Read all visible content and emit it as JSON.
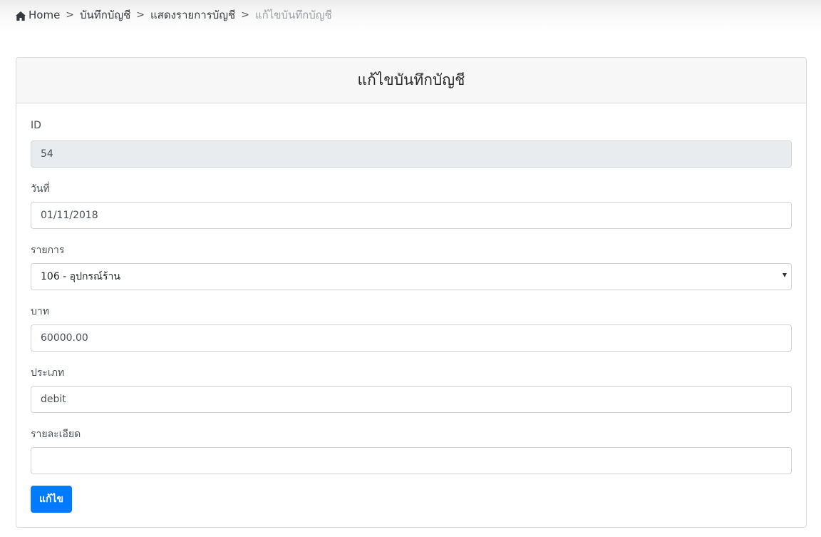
{
  "breadcrumb": {
    "home_label": "Home",
    "items": [
      "บันทึกบัญชี",
      "แสดงรายการบัญชี"
    ],
    "current": "แก้ไขบันทึกบัญชี",
    "separator": ">"
  },
  "card": {
    "title": "แก้ไขบันทึกบัญชี"
  },
  "form": {
    "id": {
      "label": "ID",
      "value": "54"
    },
    "date": {
      "label": "วันที่",
      "value": "01/11/2018"
    },
    "item": {
      "label": "รายการ",
      "selected": "106 - อุปกรณ์ร้าน"
    },
    "amount": {
      "label": "บาท",
      "value": "60000.00"
    },
    "type": {
      "label": "ประเภท",
      "value": "debit"
    },
    "detail": {
      "label": "รายละเอียด",
      "value": ""
    },
    "submit_label": "แก้ไข"
  },
  "colors": {
    "primary": "#007bff",
    "readonly_bg": "#e9ecef",
    "header_bg": "#f7f7f7"
  },
  "icons": {
    "home": "home-icon",
    "dropdown": "caret-down-icon"
  }
}
